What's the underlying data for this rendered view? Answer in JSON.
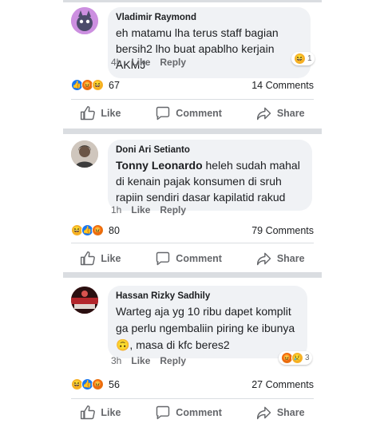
{
  "posts": [
    {
      "comment": {
        "author": "Vladimir Raymond",
        "text": "eh matamu lha terus staff bagian bersih2 lho buat apablho kerjain AKMJ",
        "mention": "",
        "time": "4h",
        "like_label": "Like",
        "reply_label": "Reply",
        "reaction_count": "1"
      },
      "reaction_count": "67",
      "comments_count": "14 Comments"
    },
    {
      "comment": {
        "author": "Doni Ari Setianto",
        "mention": "Tonny Leonardo",
        "text": "heleh sudah mahal di kenain pajak konsumen di sruh rapiin sendiri dasar kapilatid rakud",
        "time": "1h",
        "like_label": "Like",
        "reply_label": "Reply",
        "reaction_count": ""
      },
      "reaction_count": "80",
      "comments_count": "79 Comments"
    },
    {
      "comment": {
        "author": "Hassan Rizky Sadhily",
        "mention": "",
        "text": "Warteg aja yg 10 ribu dapet komplit ga perlu ngembaliin piring ke ibunya 🙃, masa di kfc beres2",
        "time": "3h",
        "like_label": "Like",
        "reply_label": "Reply",
        "reaction_count": "3"
      },
      "reaction_count": "56",
      "comments_count": "27 Comments"
    }
  ],
  "actions": {
    "like": "Like",
    "comment": "Comment",
    "share": "Share"
  },
  "icons": {
    "like": "thumbs-up-icon",
    "comment": "speech-bubble-icon",
    "share": "share-arrow-icon"
  },
  "colors": {
    "like_blue": "#1877f2",
    "haha_yellow": "#f7b125",
    "angry_orange": "#e9710f",
    "separator": "#dadde1",
    "bubble": "#f0f2f5"
  }
}
